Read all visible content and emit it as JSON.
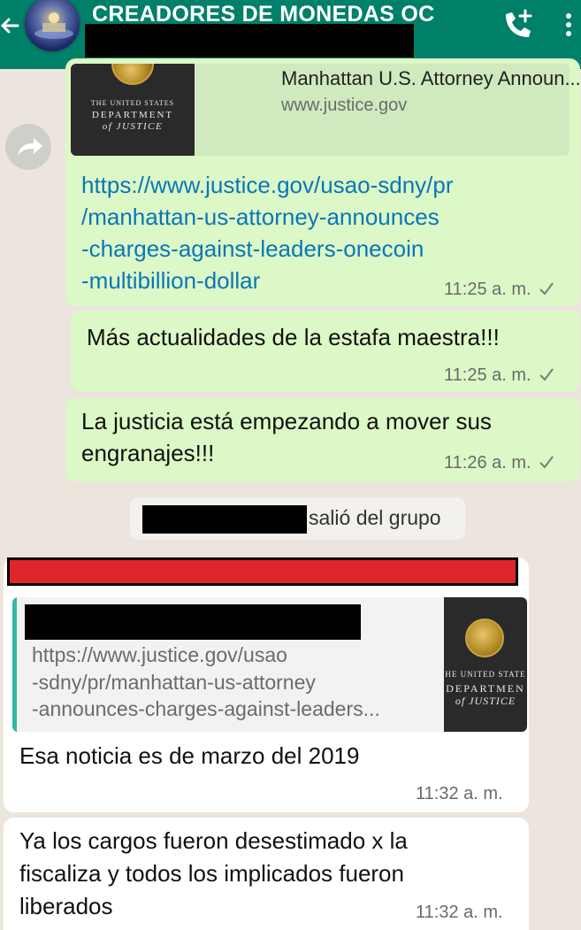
{
  "header": {
    "title": "CREADORES DE MONEDAS OC"
  },
  "messages": {
    "m1": {
      "preview": {
        "title": "Manhattan U.S. Attorney Announ...",
        "domain": "www.justice.gov",
        "thumb": {
          "line1": "THE UNITED STATES",
          "line2": "DEPARTMENT",
          "line3": "of JUSTICE"
        }
      },
      "link_lines": [
        "https://www.justice.gov/usao-sdny/pr",
        "/manhattan-us-attorney-announces",
        "-charges-against-leaders-onecoin",
        "-multibillion-dollar"
      ],
      "time": "11:25 a. m."
    },
    "m2": {
      "text": "Más actualidades de la estafa maestra!!!",
      "time": "11:25 a. m."
    },
    "m3": {
      "lines": [
        "La justicia está empezando a mover sus",
        "engranajes!!!"
      ],
      "time": "11:26 a. m."
    },
    "system": {
      "text": "salió del grupo"
    },
    "m4": {
      "preview": {
        "url_lines": [
          "https://www.justice.gov/usao",
          "-sdny/pr/manhattan-us-attorney",
          "-announces-charges-against-leaders..."
        ],
        "thumb": {
          "line1": "HE UNITED STATE",
          "line2": "DEPARTMEN",
          "line3": "of JUSTICE"
        }
      },
      "text": "Esa noticia es de marzo del 2019",
      "time": "11:32 a. m."
    },
    "m5": {
      "lines": [
        "Ya los cargos fueron desestimado x la",
        "fiscaliza y todos los implicados fueron",
        "liberados"
      ],
      "time": "11:32 a. m."
    }
  },
  "colors": {
    "header": "#008069",
    "chat_bg": "#ECE5DD",
    "outgoing": "#DCF8C6",
    "incoming": "#FFFFFF",
    "link": "#0a76b8",
    "redaction_red": "#E0242B"
  },
  "icons": [
    "back-arrow-icon",
    "add-call-icon",
    "more-vert-icon",
    "forward-share-icon",
    "single-check-icon",
    "doj-seal-icon"
  ]
}
